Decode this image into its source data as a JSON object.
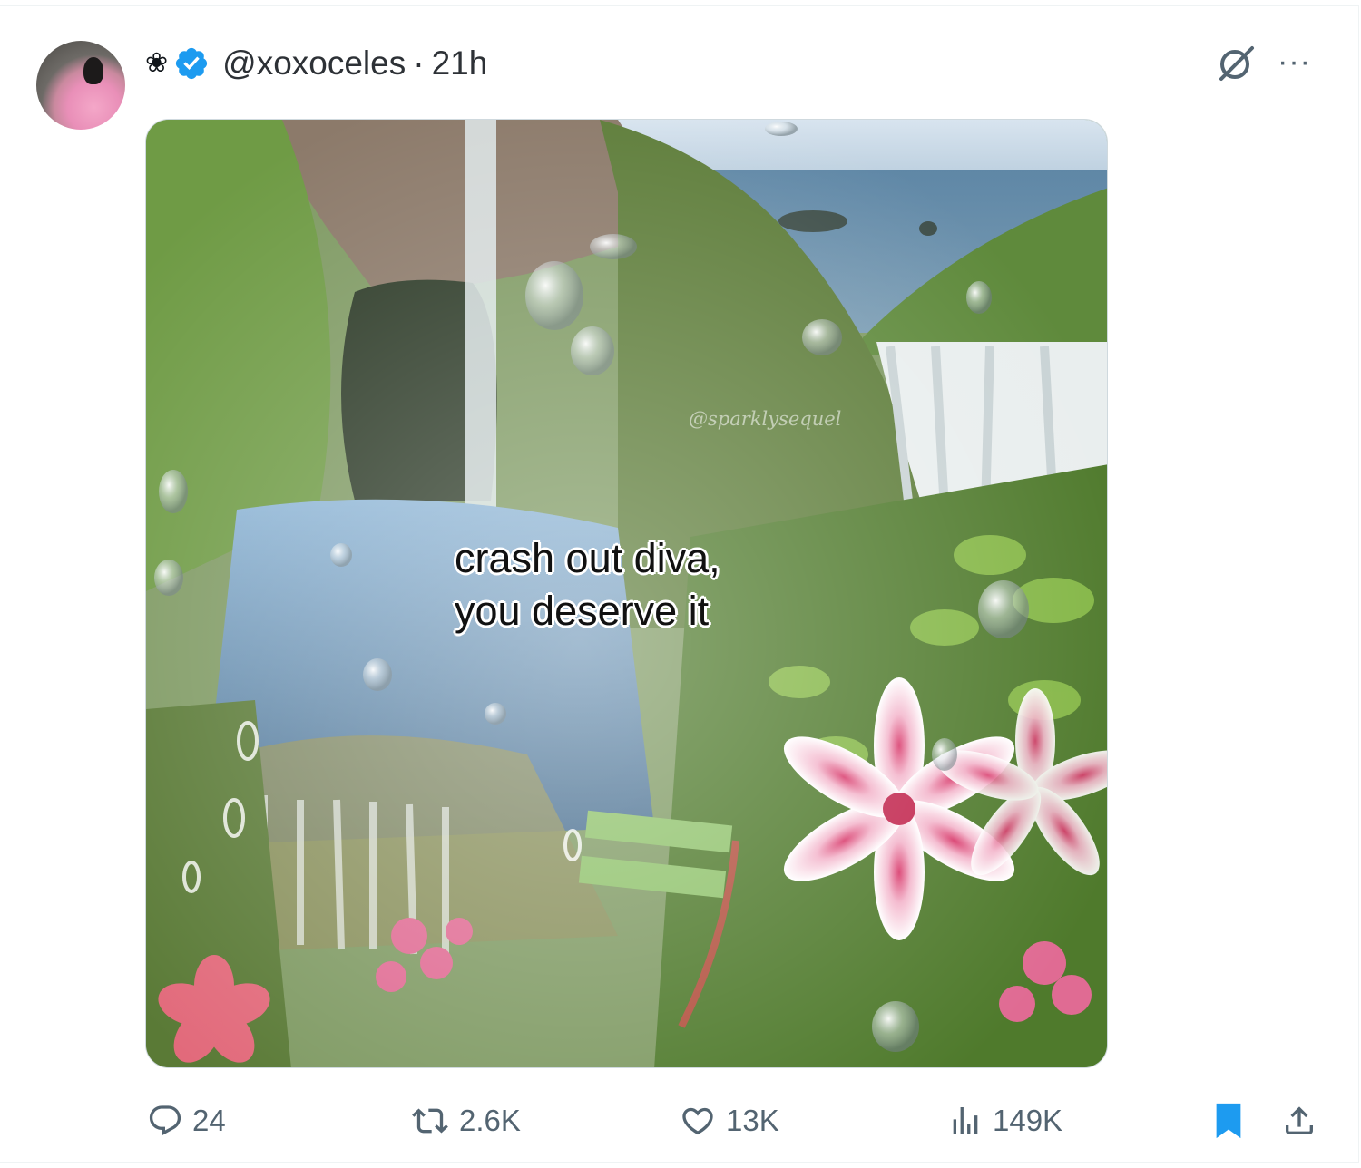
{
  "post": {
    "author_flower": "❀",
    "handle": "@xoxoceles",
    "separator": "·",
    "time": "21h",
    "avatar_icon": "profile-avatar",
    "verified_badge_color": "#1d9bf0",
    "more_label": "···",
    "media": {
      "caption_line1": "crash out diva,",
      "caption_line2": "you deserve it",
      "watermark": "@sparklysequel"
    }
  },
  "actions": {
    "replies": "24",
    "reposts": "2.6K",
    "likes": "13K",
    "views": "149K",
    "bookmark_color": "#1d9bf0",
    "icon_color": "#536471"
  }
}
